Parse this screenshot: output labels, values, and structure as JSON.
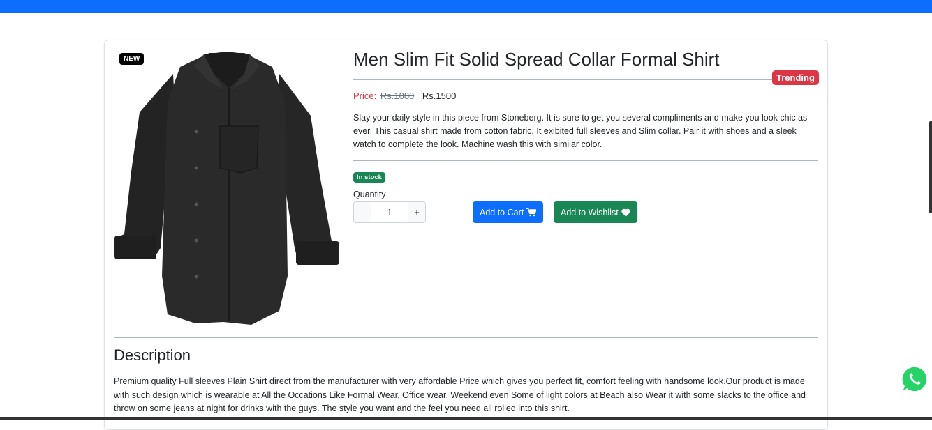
{
  "product": {
    "badge_new": "NEW",
    "title": "Men Slim Fit Solid Spread Collar Formal Shirt",
    "badge_trending": "Trending",
    "price_label": "Price:",
    "price_old": "Rs.1000",
    "price_new": "Rs.1500",
    "summary": "Slay your daily style in this piece from Stoneberg. It is sure to get you several compliments and make you look chic as ever. This casual shirt made from cotton fabric. It exibited full sleeves and Slim collar. Pair it with shoes and a sleek watch to complete the look. Machine wash this with similar color.",
    "stock_status": "In stock",
    "quantity_label": "Quantity",
    "quantity_value": "1",
    "qty_minus": "-",
    "qty_plus": "+",
    "add_to_cart_label": "Add to Cart",
    "add_to_wishlist_label": "Add to Wishlist"
  },
  "description": {
    "heading": "Description",
    "text": "Premium quality Full sleeves Plain Shirt direct from the manufacturer with very affordable Price which gives you perfect fit, comfort feeling with handsome look.Our product is made with such design which is wearable at All the Occations Like Formal Wear, Office wear, Weekend even Some of light colors at Beach also Wear it with some slacks to the office and throw on some jeans at night for drinks with the guys. The style you want and the feel you need all rolled into this shirt."
  },
  "icons": {
    "cart": "cart-icon",
    "wishlist": "heart-icon",
    "whatsapp": "whatsapp-icon"
  },
  "colors": {
    "primary": "#0d6efd",
    "success": "#198754",
    "danger": "#dc3545",
    "whatsapp": "#25d366"
  }
}
